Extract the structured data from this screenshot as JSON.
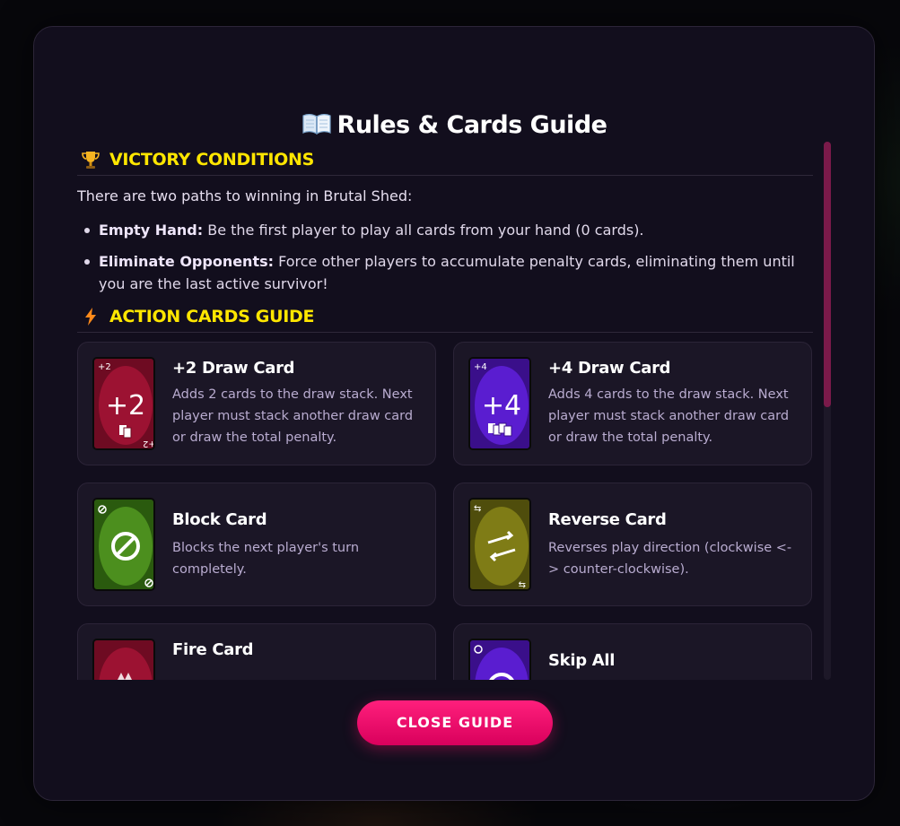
{
  "modal": {
    "title": "Rules & Cards Guide",
    "icon": "open-book-icon"
  },
  "victory": {
    "heading": "VICTORY CONDITIONS",
    "icon": "trophy-icon",
    "intro": "There are two paths to winning in Brutal Shed:",
    "items": [
      {
        "label": "Empty Hand:",
        "text": " Be the first player to play all cards from your hand (0 cards)."
      },
      {
        "label": "Eliminate Opponents:",
        "text": " Force other players to accumulate penalty cards, eliminating them until you are the last active survivor!"
      }
    ]
  },
  "actions": {
    "heading": "ACTION CARDS GUIDE",
    "icon": "lightning-icon",
    "cards": [
      {
        "title": "+2 Draw Card",
        "desc": "Adds 2 cards to the draw stack. Next player must stack another draw card or draw the total penalty.",
        "face": "+2",
        "corner": "+2",
        "color": "#8a0f2a"
      },
      {
        "title": "+4 Draw Card",
        "desc": "Adds 4 cards to the draw stack. Next player must stack another draw card or draw the total penalty.",
        "face": "+4",
        "corner": "+4",
        "color": "#4d14b8"
      },
      {
        "title": "Block Card",
        "desc": "Blocks the next player's turn completely.",
        "face": "block",
        "corner": "⊘",
        "color": "#3e7a16"
      },
      {
        "title": "Reverse Card",
        "desc": "Reverses play direction (clockwise <-> counter-clockwise).",
        "face": "reverse",
        "corner": "⇆",
        "color": "#6e6a12"
      },
      {
        "title": "Fire Card",
        "desc": "",
        "face": "fire",
        "corner": "",
        "color": "#8a0f2a"
      },
      {
        "title": "Skip All",
        "desc": "",
        "face": "skip",
        "corner": "",
        "color": "#4d14b8"
      }
    ]
  },
  "close_button": {
    "label": "CLOSE GUIDE"
  },
  "colors": {
    "accent_yellow": "#ffe600",
    "accent_pink": "#ff1f7c",
    "panel_bg": "#120e1d"
  }
}
